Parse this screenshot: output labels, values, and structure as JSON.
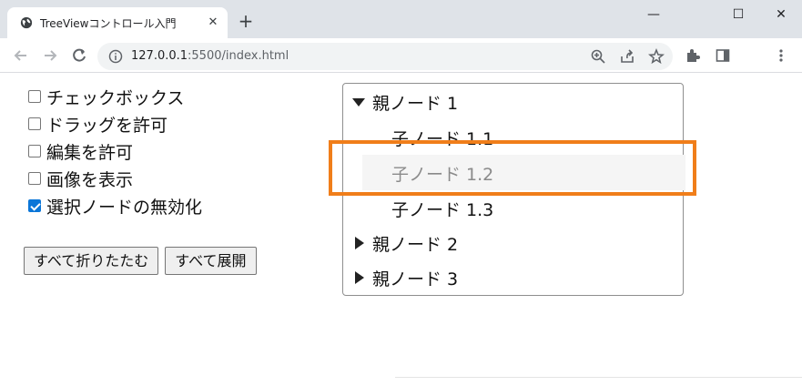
{
  "browser": {
    "tab_title": "TreeViewコントロール入門",
    "tab_close": "✕",
    "new_tab": "+",
    "window": {
      "minimize": "—",
      "maximize": "☐",
      "close": "✕"
    },
    "url_host": "127.0.0.1",
    "url_rest": ":5500/index.html"
  },
  "options": [
    {
      "label": "チェックボックス",
      "checked": false
    },
    {
      "label": "ドラッグを許可",
      "checked": false
    },
    {
      "label": "編集を許可",
      "checked": false
    },
    {
      "label": "画像を表示",
      "checked": false
    },
    {
      "label": "選択ノードの無効化",
      "checked": true
    }
  ],
  "buttons": {
    "collapse_all": "すべて折りたたむ",
    "expand_all": "すべて展開"
  },
  "tree": {
    "nodes": [
      {
        "label": "親ノード 1",
        "level": 0,
        "expanded": true
      },
      {
        "label": "子ノード 1.1",
        "level": 1
      },
      {
        "label": "子ノード 1.2",
        "level": 1,
        "disabled": true
      },
      {
        "label": "子ノード 1.3",
        "level": 1
      },
      {
        "label": "親ノード 2",
        "level": 0,
        "expanded": false
      },
      {
        "label": "親ノード 3",
        "level": 0,
        "expanded": false
      }
    ]
  },
  "colors": {
    "highlight": "#f07e1a",
    "checkbox_checked": "#0b76d8",
    "disabled_text": "#8a8a8a"
  }
}
